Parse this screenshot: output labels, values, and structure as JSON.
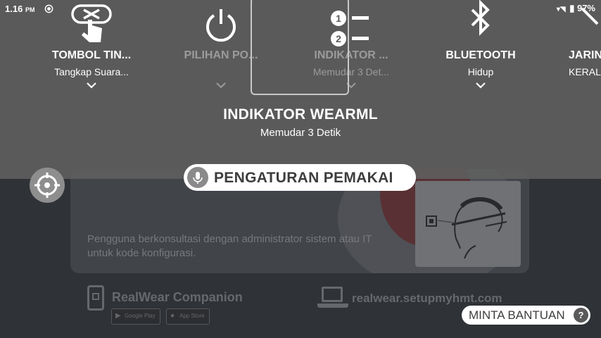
{
  "status_bar": {
    "time": "1.16",
    "ampm": "PM",
    "battery": "97%"
  },
  "carousel": [
    {
      "title": "TOMBOL TIN...",
      "subtitle": "Tangkap Suara...",
      "icon": "touch-gesture-icon",
      "focused": false
    },
    {
      "title": "PILIHAN PO...",
      "subtitle": "",
      "icon": "power-icon",
      "focused": false
    },
    {
      "title": "INDIKATOR ...",
      "subtitle": "Memudar 3 Det...",
      "icon": "numbered-list-icon",
      "focused": true
    },
    {
      "title": "BLUETOOTH",
      "subtitle": "Hidup",
      "icon": "bluetooth-icon",
      "focused": false
    },
    {
      "title": "JARIN",
      "subtitle": "KERAL",
      "icon": "network-icon",
      "focused": false
    }
  ],
  "selected": {
    "title": "INDIKATOR WEARML",
    "subtitle": "Memudar 3 Detik"
  },
  "user_settings_label": "PENGATURAN PEMAKAI",
  "help_label": "MINTA BANTUAN",
  "help_glyph": "?",
  "background": {
    "hint_text": "Pengguna berkonsultasi dengan administrator sistem atau IT untuk kode konfigurasi.",
    "companion_title": "RealWear Companion",
    "google_play_label": "Google Play",
    "app_store_label": "App Store",
    "setup_url": "realwear.setupmyhmt.com"
  },
  "colors": {
    "overlay": "#5c5c5c",
    "pill_bg": "#ffffff",
    "text_primary": "#ffffff",
    "text_faded": "#9b9b9b"
  }
}
